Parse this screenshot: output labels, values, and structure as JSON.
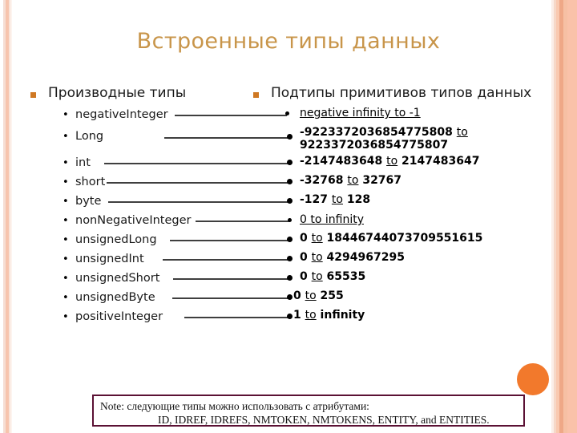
{
  "slide": {
    "title": "Встроенные типы данных",
    "accent_title_color": "#c8954a",
    "bullet_square_color": "#cf7823",
    "circle_decor_color": "#f2792c"
  },
  "left_column": {
    "heading": "Производные типы",
    "items": [
      {
        "label": "negativeInteger"
      },
      {
        "label": "Long"
      },
      {
        "label": "int"
      },
      {
        "label": "short"
      },
      {
        "label": "byte"
      },
      {
        "label": "nonNegativeInteger"
      },
      {
        "label": "unsignedLong"
      },
      {
        "label": "unsignedInt"
      },
      {
        "label": "unsignedShort"
      },
      {
        "label": "unsignedByte"
      },
      {
        "label": "positiveInteger"
      }
    ]
  },
  "right_column": {
    "heading": "Подтипы примитивов типов данных",
    "items": [
      {
        "text": "negative infinity to -1",
        "bold": false
      },
      {
        "text": "-9223372036854775808 to 9223372036854775807",
        "bold": true
      },
      {
        "text": "-2147483648 to 2147483647",
        "bold": true
      },
      {
        "text": "-32768 to 32767",
        "bold": true
      },
      {
        "text": "-127 to 128",
        "bold": true
      },
      {
        "text": "0 to infinity",
        "bold": false
      },
      {
        "text": "0 to 18446744073709551615",
        "bold": true
      },
      {
        "text": "0 to 4294967295",
        "bold": true
      },
      {
        "text": "0 to 65535",
        "bold": true
      },
      {
        "text": "0 to 255",
        "bold": true
      },
      {
        "text": "1 to infinity",
        "bold": true
      }
    ]
  },
  "note": {
    "line1": "Note: следующие типы можно использовать с атрибутами:",
    "line2": "ID, IDREF, IDREFS, NMTOKEN, NMTOKENS, ENTITY, and ENTITIES.",
    "border_color": "#5b1134"
  }
}
